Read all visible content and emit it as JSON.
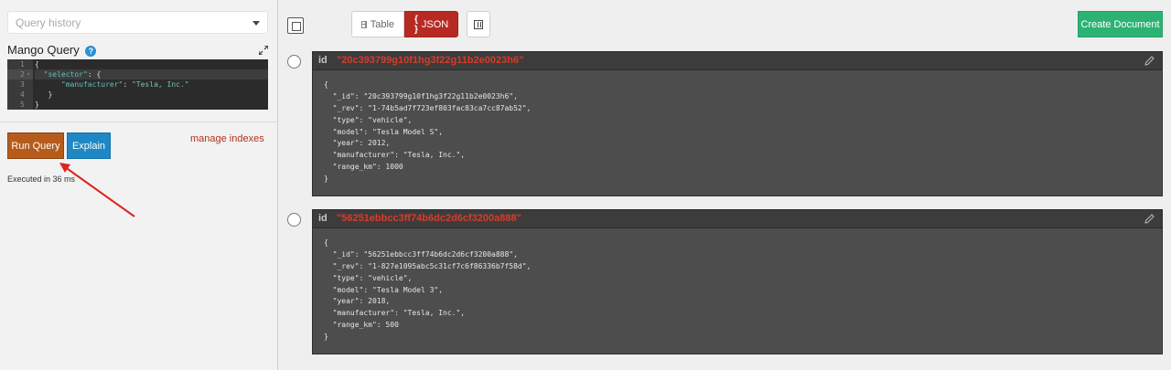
{
  "sidebar": {
    "query_history_placeholder": "Query history",
    "mango_title": "Mango Query",
    "help_glyph": "?",
    "editor": {
      "line_numbers": [
        "1",
        "2",
        "3",
        "4",
        "5"
      ],
      "line1": "{",
      "line2_key": "\"selector\"",
      "line2_rest": ": {",
      "line3_key": "\"manufacturer\"",
      "line3_sep": ": ",
      "line3_val": "\"Tesla, Inc.\"",
      "line4": "}",
      "line5": "}"
    },
    "run_query_label": "Run Query",
    "explain_label": "Explain",
    "manage_indexes_label": "manage indexes",
    "executed_text": "Executed in 36 ms"
  },
  "toolbar": {
    "table_label": "Table",
    "json_label": "JSON",
    "json_icon": "{ }",
    "create_document_label": "Create Document"
  },
  "documents": [
    {
      "id_label": "id",
      "id": "\"20c393799g10f1hg3f22g11b2e0023h6\"",
      "lines": [
        "{",
        "  \"_id\": \"20c393799g10f1hg3f22g11b2e0023h6\",",
        "  \"_rev\": \"1-74b5ad7f723ef803fac83ca7cc87ab52\",",
        "  \"type\": \"vehicle\",",
        "  \"model\": \"Tesla Model S\",",
        "  \"year\": 2012,",
        "  \"manufacturer\": \"Tesla, Inc.\",",
        "  \"range_km\": 1000",
        "}"
      ]
    },
    {
      "id_label": "id",
      "id": "\"56251ebbcc3ff74b6dc2d6cf3200a888\"",
      "lines": [
        "{",
        "  \"_id\": \"56251ebbcc3ff74b6dc2d6cf3200a888\",",
        "  \"_rev\": \"1-827e1095abc5c31cf7c6f86336b7f58d\",",
        "  \"type\": \"vehicle\",",
        "  \"model\": \"Tesla Model 3\",",
        "  \"year\": 2018,",
        "  \"manufacturer\": \"Tesla, Inc.\",",
        "  \"range_km\": 500",
        "}"
      ]
    }
  ],
  "colors": {
    "run_query": "#b55b1c",
    "explain": "#1f87c4",
    "json_active": "#b72a24",
    "create_document": "#2cb374",
    "doc_id": "#d93b2a",
    "annotation_arrow": "#d9251c"
  },
  "icons": [
    "chevron-down-icon",
    "help-icon",
    "expand-icon",
    "table-icon",
    "json-braces-icon",
    "columns-icon",
    "pencil-icon"
  ]
}
